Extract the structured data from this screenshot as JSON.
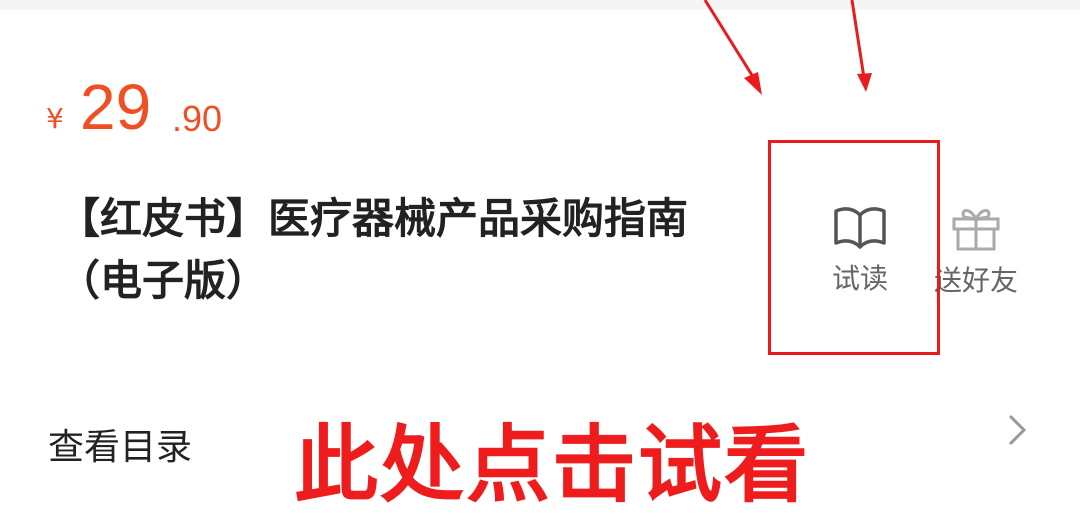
{
  "product": {
    "currency_symbol": "¥",
    "price_integer": "29",
    "price_decimal": ".90",
    "title_line1": "【红皮书】医疗器械产品采购指南",
    "title_line2": "（电子版）"
  },
  "actions": {
    "trial_read_label": "试读",
    "gift_friend_label": "送好友"
  },
  "catalog": {
    "view_toc_label": "查看目录"
  },
  "annotation": {
    "text": "此处点击试看"
  },
  "colors": {
    "price": "#f04e23",
    "annotation": "#ee1c1c"
  },
  "icons": {
    "trial_read": "open-book-icon",
    "gift": "gift-icon",
    "toc": "chevron-right-icon"
  }
}
